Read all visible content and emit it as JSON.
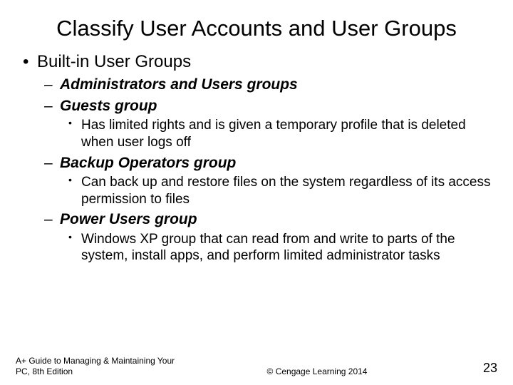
{
  "title": "Classify User Accounts and User Groups",
  "bullets": {
    "top": "Built-in User Groups",
    "g0": "Administrators and Users groups",
    "g1": "Guests group",
    "g1_sub": "Has limited rights and is given a temporary profile that is deleted when user logs off",
    "g2": "Backup Operators group",
    "g2_sub": "Can back up and restore files on the system regardless of its access permission to files",
    "g3": "Power Users group",
    "g3_sub": "Windows XP group that can read from and write to parts of the system, install apps, and perform limited administrator tasks"
  },
  "footer": {
    "left": "A+ Guide to Managing & Maintaining Your PC, 8th Edition",
    "center": "© Cengage Learning 2014",
    "page": "23"
  }
}
